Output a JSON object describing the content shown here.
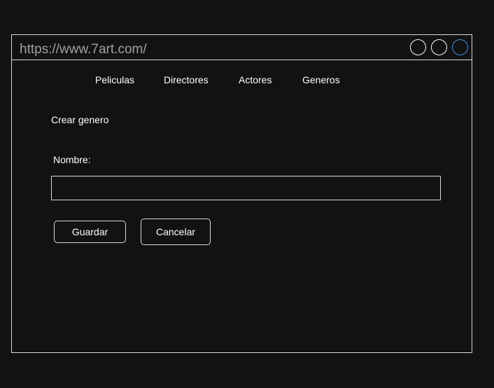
{
  "browser": {
    "url": "https://www.7art.com/",
    "window_controls": [
      {
        "name": "window-control-1",
        "color": "#ffffff"
      },
      {
        "name": "window-control-2",
        "color": "#ffffff"
      },
      {
        "name": "window-control-3",
        "color": "#3d8fe0"
      }
    ]
  },
  "nav": {
    "items": [
      {
        "label": "Peliculas"
      },
      {
        "label": "Directores"
      },
      {
        "label": "Actores"
      },
      {
        "label": "Generos"
      }
    ]
  },
  "form": {
    "title": "Crear genero",
    "name_label": "Nombre:",
    "name_value": "",
    "name_placeholder": "",
    "save_label": "Guardar",
    "cancel_label": "Cancelar"
  },
  "colors": {
    "background": "#121212",
    "border": "#d9d9d9",
    "text": "#ffffff",
    "url_text": "#a0a0a0",
    "accent": "#3d8fe0"
  }
}
